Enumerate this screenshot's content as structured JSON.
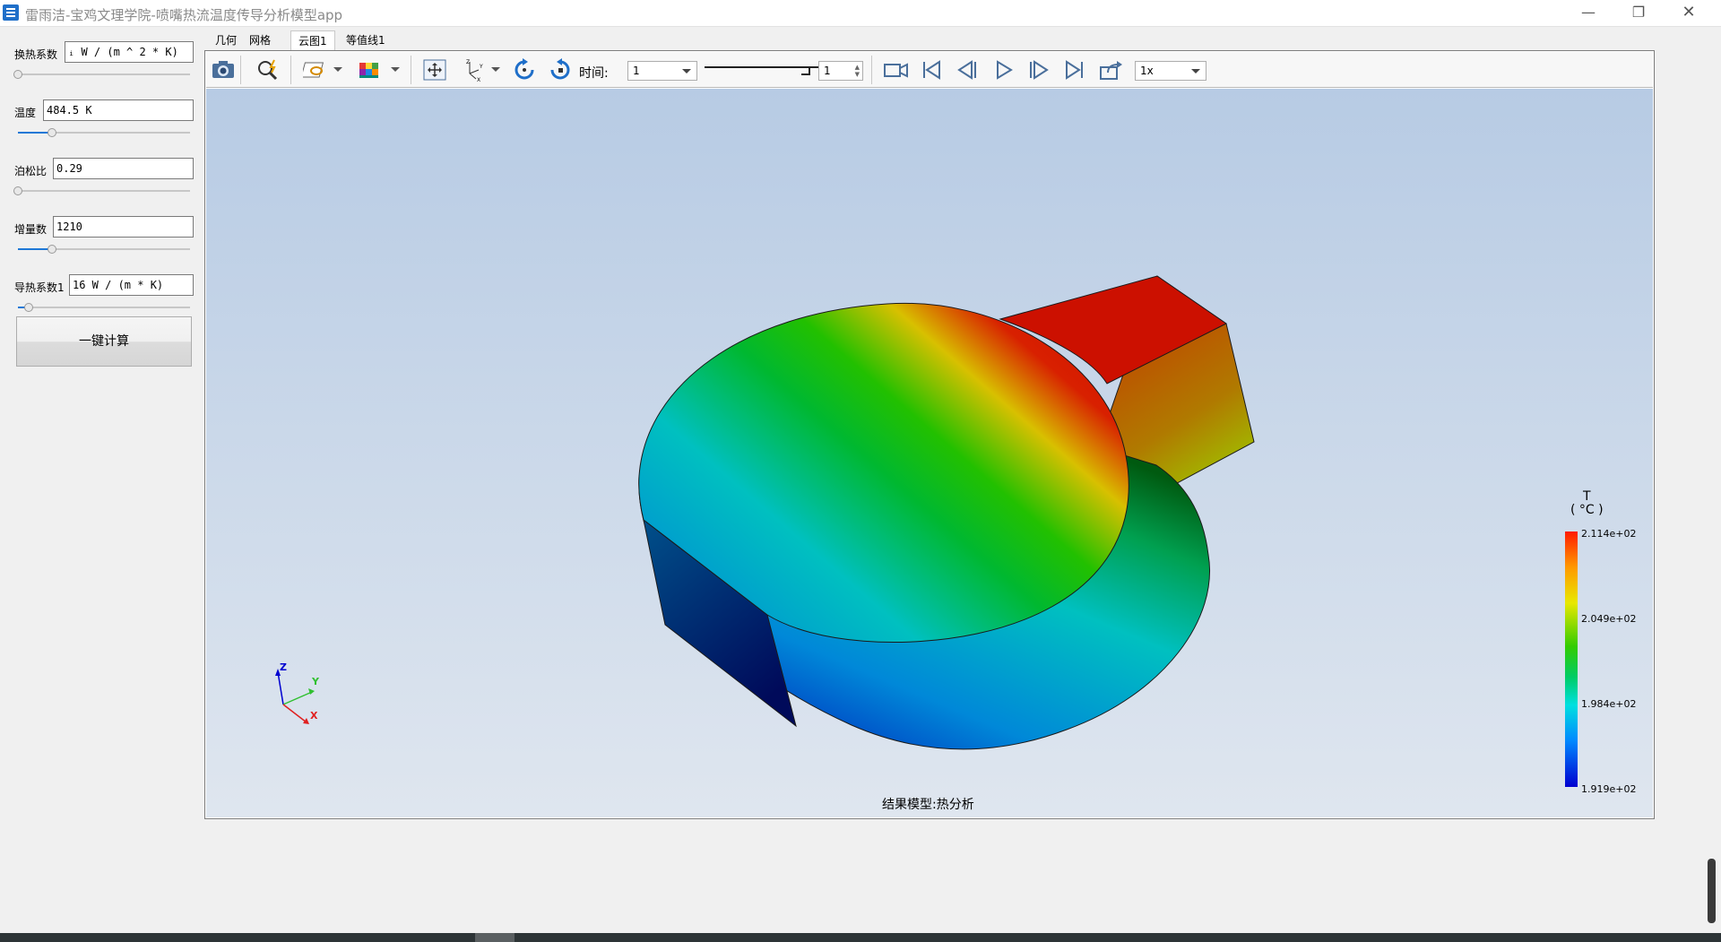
{
  "window": {
    "title": "雷雨洁-宝鸡文理学院-喷嘴热流温度传导分析模型app",
    "min_icon": "minimize-icon",
    "max_icon": "restore-icon",
    "close_icon": "close-icon"
  },
  "params": [
    {
      "label": "换热系数",
      "value": "ᵢ W / (m ^ 2  * K)",
      "slider_level": 0.0
    },
    {
      "label": "温度",
      "value": "484.5 K",
      "slider_level": 0.2
    },
    {
      "label": "泊松比",
      "value": "0.29",
      "slider_level": 0.0
    },
    {
      "label": "增量数",
      "value": "1210",
      "slider_level": 0.2
    },
    {
      "label": "导热系数1",
      "value": "16 W / (m * K)",
      "slider_level": 0.06
    }
  ],
  "calc_button": "一键计算",
  "tabs": [
    "几何",
    "网格",
    "云图1",
    "等值线1"
  ],
  "active_tab": 2,
  "toolbar": {
    "time_label": "时间:",
    "time_value": "1",
    "step_value": "1",
    "speed_value": "1x",
    "icons": [
      "camera-icon",
      "zoom-icon",
      "view-plane-icon",
      "color-cube-icon",
      "fit-view-icon",
      "axis-triad-icon",
      "rotate-cw-icon",
      "rotate-ccw-icon",
      "record-video-icon",
      "first-frame-icon",
      "prev-frame-icon",
      "play-icon",
      "next-frame-icon",
      "last-frame-icon",
      "export-icon"
    ]
  },
  "legend": {
    "title_var": "T",
    "title_unit": "( °C )",
    "labels": [
      "2.114e+02",
      "2.049e+02",
      "1.984e+02",
      "1.919e+02"
    ],
    "color_max": "#ff1a00",
    "color_min": "#0000d0"
  },
  "triad": {
    "z": "Z",
    "y": "Y",
    "x": "X"
  },
  "caption": "结果模型:热分析"
}
